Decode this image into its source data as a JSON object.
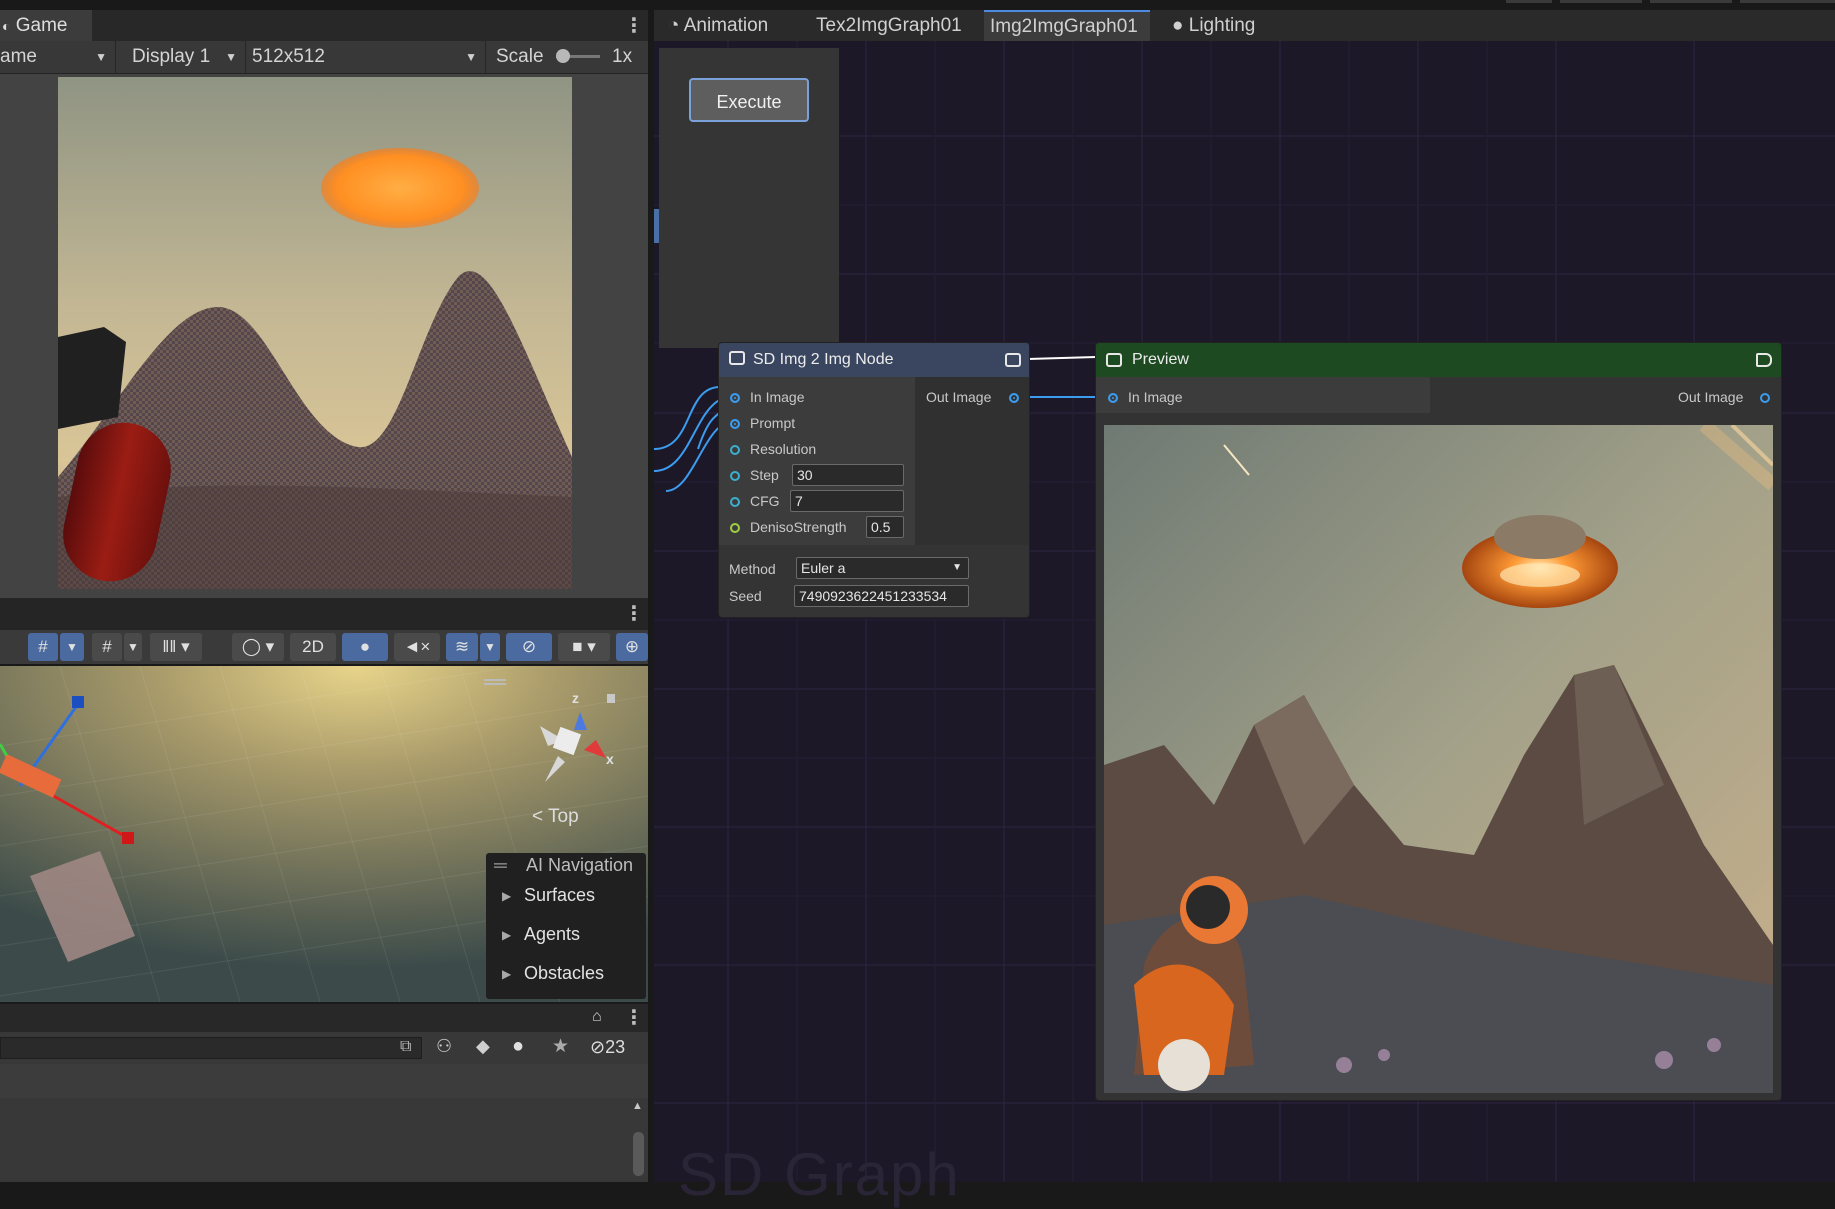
{
  "game_panel": {
    "tab_label": "Game",
    "mode_dropdown": "ame",
    "display_dropdown": "Display 1",
    "resolution_dropdown": "512x512",
    "scale_label": "Scale",
    "scale_value": "1x"
  },
  "scene_panel": {
    "toolbar": {
      "toggle_2d": "2D"
    },
    "gizmo": {
      "axis_x": "x",
      "axis_z": "z",
      "view_label": "Top"
    },
    "ai_navigation": {
      "title": "AI Navigation",
      "items": [
        "Surfaces",
        "Agents",
        "Obstacles"
      ]
    }
  },
  "console_panel": {
    "hidden_count": "23"
  },
  "editor_tabs": [
    {
      "label": "Animation",
      "icon": "clock-icon"
    },
    {
      "label": "Tex2ImgGraph01"
    },
    {
      "label": "Img2ImgGraph01",
      "active": true
    },
    {
      "label": "Lighting",
      "icon": "bulb-icon"
    }
  ],
  "graph": {
    "execute_label": "Execute",
    "watermark": "SD Graph",
    "sd_node": {
      "title": "SD Img 2 Img Node",
      "inputs": [
        "In Image",
        "Prompt",
        "Resolution",
        "Step",
        "CFG",
        "DenisoStrength"
      ],
      "output": "Out Image",
      "step_value": "30",
      "cfg_value": "7",
      "denoise_value": "0.5",
      "method_label": "Method",
      "method_value": "Euler a",
      "seed_label": "Seed",
      "seed_value": "7490923622451233534"
    },
    "preview_node": {
      "title": "Preview",
      "input": "In Image",
      "output": "Out Image"
    }
  },
  "colors": {
    "accent_blue": "#4d8ae0",
    "graph_bg": "#1d1828",
    "preview_header": "#1e4a22",
    "sd_header": "#3a4660"
  }
}
